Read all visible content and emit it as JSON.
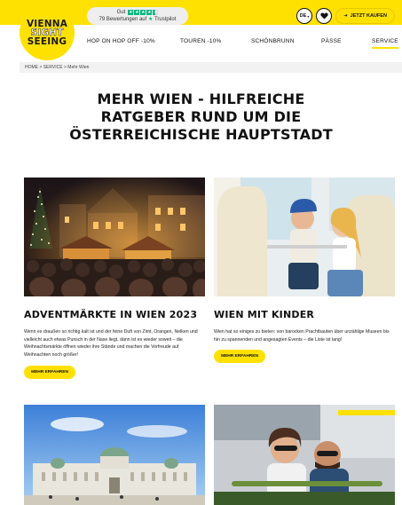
{
  "brand": {
    "logo_line1": "VIENNA",
    "logo_line2": "SIGHT",
    "logo_line3": "SEEING",
    "color_yellow": "#ffe100"
  },
  "trustpilot": {
    "rating_word": "Gut",
    "reviews_text": "79 Bewertungen auf",
    "platform": "Trustpilot",
    "stars": 4.5
  },
  "header": {
    "language": "DE",
    "buy_label": "JETZT KAUFEN"
  },
  "nav": [
    {
      "label": "HOP ON HOP OFF -10%"
    },
    {
      "label": "TOUREN -10%"
    },
    {
      "label": "SCHÖNBRUNN"
    },
    {
      "label": "PÄSSE"
    },
    {
      "label": "SERVICE",
      "active": true
    }
  ],
  "breadcrumb": {
    "home": "HOME",
    "sep1": ">",
    "service": "SERVICE",
    "sep2": ">",
    "current": "Mehr Wien"
  },
  "page": {
    "title_line1": "MEHR WIEN - HILFREICHE",
    "title_line2": "RATGEBER RUND UM DIE",
    "title_line3": "ÖSTERREICHISCHE HAUPTSTADT"
  },
  "cards": [
    {
      "title": "ADVENTMÄRKTE IN WIEN 2023",
      "text": "Wenn es draußen so richtig kalt ist und der feine Duft von Zimt, Orangen, Nelken und vielleicht auch etwas Punsch in der Nase liegt, dann ist es wieder soweit – die Weihnachtsmärkte öffnen wieder ihre Stände und machen die Vorfreude auf Weihnachten noch größer!",
      "button": "MEHR ERFAHREN"
    },
    {
      "title": "WIEN MIT KINDER",
      "text": "Wien hat so einiges zu bieten: von barocken Prachtbauten über unzählige Museen bis hin zu spannenden und angesagten Events – die Liste ist lang!",
      "button": "MEHR ERFAHREN"
    }
  ]
}
